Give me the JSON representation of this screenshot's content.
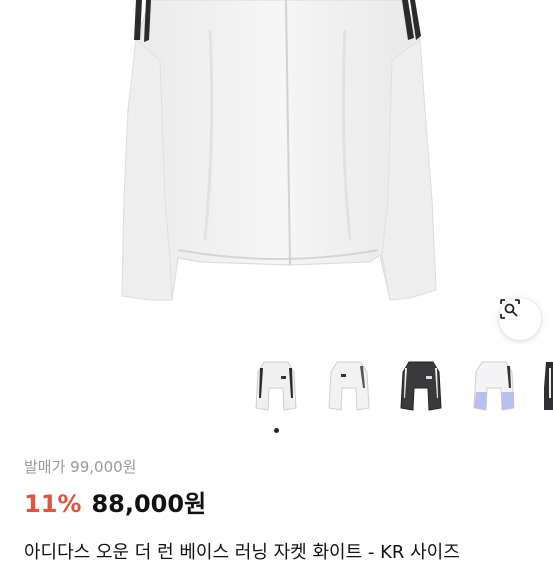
{
  "product": {
    "original_price_text": "발매가 99,000원",
    "discount_text": "11%",
    "sale_price_text": "88,000원",
    "title": "아디다스 오운 더 런 베이스 러닝 자켓 화이트 - KR 사이즈"
  },
  "gallery": {
    "lens_icon": "visual-search-icon",
    "thumbnails": [
      {
        "name": "white-black-stripes"
      },
      {
        "name": "white-jacket"
      },
      {
        "name": "black-jacket"
      },
      {
        "name": "white-lavender-jacket"
      },
      {
        "name": "black-jacket-partial"
      }
    ],
    "active_index": 0
  },
  "colors": {
    "discount": "#e0533c",
    "price": "#111111",
    "muted": "#9a9a9a"
  }
}
